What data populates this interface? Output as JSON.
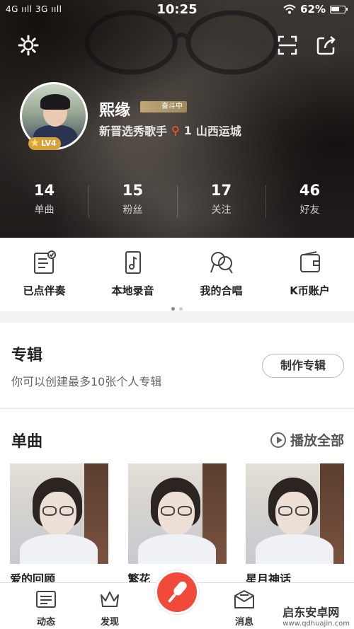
{
  "status_bar": {
    "network": "4G ııll 3G ııll",
    "time": "10:25",
    "battery": "62%"
  },
  "profile": {
    "name": "熙缘",
    "badge": "奋斗中",
    "title": "新晋选秀歌手",
    "rank": "1",
    "location": "山西运城",
    "level": "LV4"
  },
  "stats": [
    {
      "value": "14",
      "label": "单曲"
    },
    {
      "value": "15",
      "label": "粉丝"
    },
    {
      "value": "17",
      "label": "关注"
    },
    {
      "value": "46",
      "label": "好友"
    }
  ],
  "quick_actions": [
    {
      "label": "已点伴奏",
      "icon": "checklist-icon"
    },
    {
      "label": "本地录音",
      "icon": "music-file-icon"
    },
    {
      "label": "我的合唱",
      "icon": "duet-icon"
    },
    {
      "label": "K币账户",
      "icon": "wallet-icon"
    }
  ],
  "album": {
    "title": "专辑",
    "description": "你可以创建最多10张个人专辑",
    "button": "制作专辑"
  },
  "singles": {
    "title": "单曲",
    "play_all": "播放全部",
    "songs": [
      {
        "name": "爱的回顾"
      },
      {
        "name": "繁花"
      },
      {
        "name": "星月神话"
      }
    ]
  },
  "tabbar": {
    "tabs": [
      {
        "label": "动态",
        "icon": "feed-icon"
      },
      {
        "label": "发现",
        "icon": "crown-icon"
      },
      {
        "label": "消息",
        "icon": "message-icon"
      }
    ],
    "record_icon": "microphone-icon"
  },
  "watermark": {
    "text": "启东安卓网",
    "url": "www.qdhuajin.com"
  },
  "colors": {
    "accent": "#f24a3a",
    "level_badge": "#d8a23a",
    "location_pin": "#ff5a2d"
  }
}
